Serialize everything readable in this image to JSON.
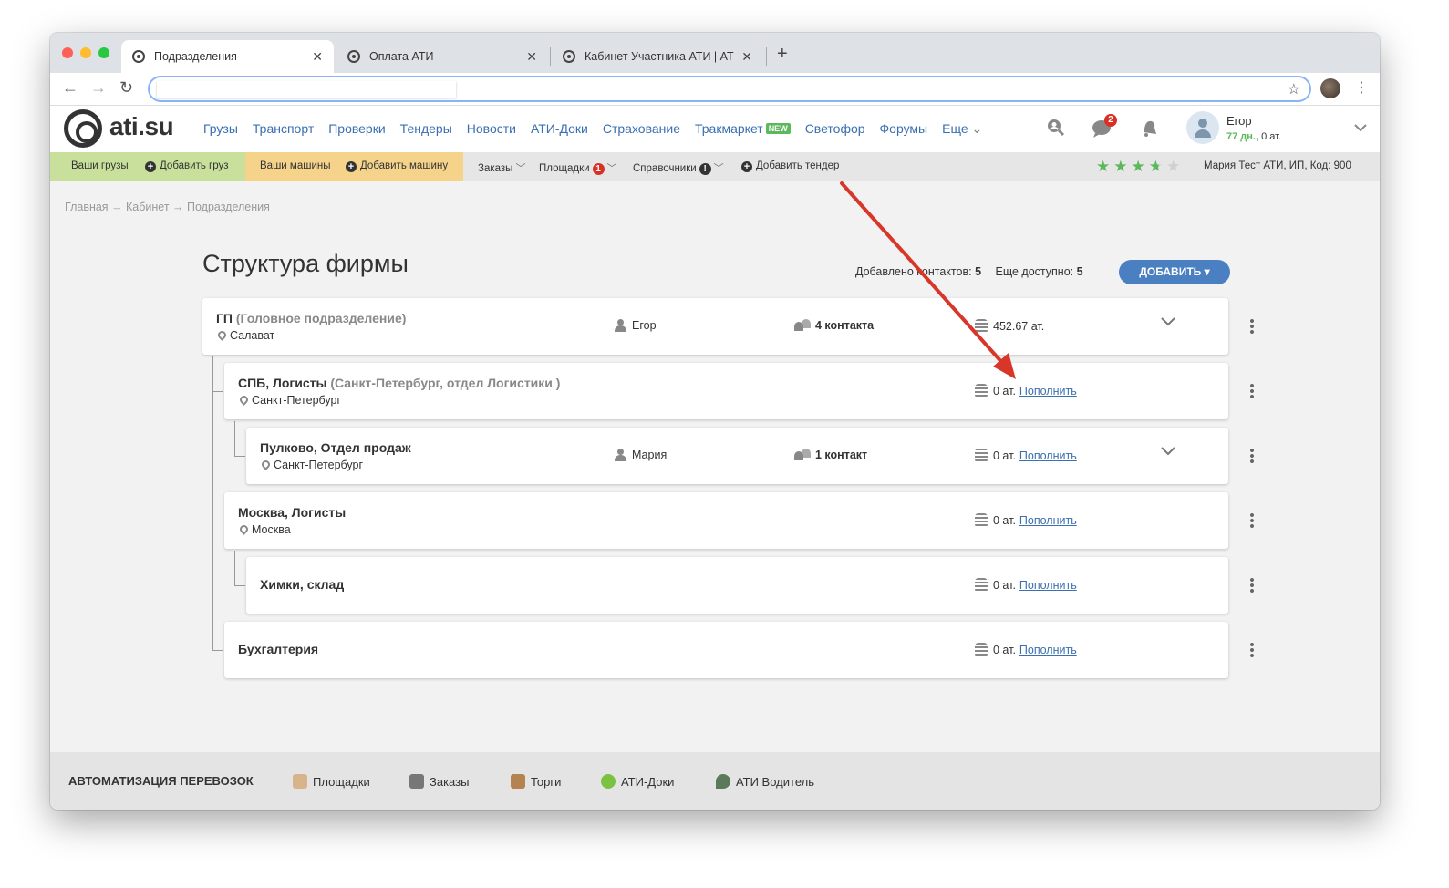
{
  "browser": {
    "tabs": [
      {
        "title": "Подразделения",
        "close": "✕"
      },
      {
        "title": "Оплата АТИ",
        "close": "✕"
      },
      {
        "title": "Кабинет Участника АТИ | АТИ",
        "close": "✕"
      }
    ],
    "new_tab": "+",
    "nav": {
      "back": "←",
      "forward": "→",
      "reload": "↻"
    },
    "bookmark_icon": "☆",
    "menu_icon": "⋮"
  },
  "header": {
    "logo_text": "ati.su",
    "nav": [
      "Грузы",
      "Транспорт",
      "Проверки",
      "Тендеры",
      "Новости",
      "АТИ-Доки",
      "Страхование",
      "Тракмаркет",
      "Светофор",
      "Форумы",
      "Еще"
    ],
    "new_badge": "NEW",
    "more_chevron": "⌄",
    "messages_badge": "2",
    "user": {
      "name": "Егор",
      "days": "77 дн.,",
      "balance": "0 ат."
    }
  },
  "subnav": {
    "my_cargo": "Ваши грузы",
    "add_cargo": "Добавить груз",
    "my_trucks": "Ваши машины",
    "add_truck": "Добавить машину",
    "orders": "Заказы",
    "platforms": "Площадки",
    "platforms_badge": "1",
    "directories": "Справочники",
    "directories_badge": "!",
    "add_tender": "Добавить тендер",
    "rating_stars": 3.5,
    "company": "Мария Тест АТИ, ИП,  Код: 900"
  },
  "breadcrumb": "Главная → Кабинет → Подразделения",
  "page": {
    "title": "Структура фирмы",
    "contacts_added_label": "Добавлено контактов:",
    "contacts_added_value": "5",
    "available_label": "Еще доступно:",
    "available_value": "5",
    "add_button": "ДОБАВИТЬ ▾"
  },
  "units": [
    {
      "name": "ГП",
      "subtitle": "(Головное подразделение)",
      "city": "Салават",
      "person": "Егор",
      "contacts": "4 контакта",
      "balance": "452.67 ат.",
      "topup": ""
    },
    {
      "name": "СПБ, Логисты",
      "subtitle": "(Санкт-Петербург, отдел Логистики )",
      "city": "Санкт-Петербург",
      "person": "",
      "contacts": "",
      "balance": "0 ат.",
      "topup": "Пополнить"
    },
    {
      "name": "Пулково, Отдел продаж",
      "subtitle": "",
      "city": "Санкт-Петербург",
      "person": "Мария",
      "contacts": "1 контакт",
      "balance": "0 ат.",
      "topup": "Пополнить"
    },
    {
      "name": "Москва, Логисты",
      "subtitle": "",
      "city": "Москва",
      "person": "",
      "contacts": "",
      "balance": "0 ат.",
      "topup": "Пополнить"
    },
    {
      "name": "Химки, склад",
      "subtitle": "",
      "city": "",
      "person": "",
      "contacts": "",
      "balance": "0 ат.",
      "topup": "Пополнить"
    },
    {
      "name": "Бухгалтерия",
      "subtitle": "",
      "city": "",
      "person": "",
      "contacts": "",
      "balance": "0 ат.",
      "topup": "Пополнить"
    }
  ],
  "footer": {
    "title": "АВТОМАТИЗАЦИЯ ПЕРЕВОЗОК",
    "items": [
      "Площадки",
      "Заказы",
      "Торги",
      "АТИ-Доки",
      "АТИ Водитель"
    ]
  },
  "colors": {
    "accent": "#4a7fc1",
    "link": "#3a6fb0",
    "cargo_bar": "#c8e09c",
    "trucks_bar": "#f5d38a",
    "annotation_arrow": "#d9362a"
  }
}
